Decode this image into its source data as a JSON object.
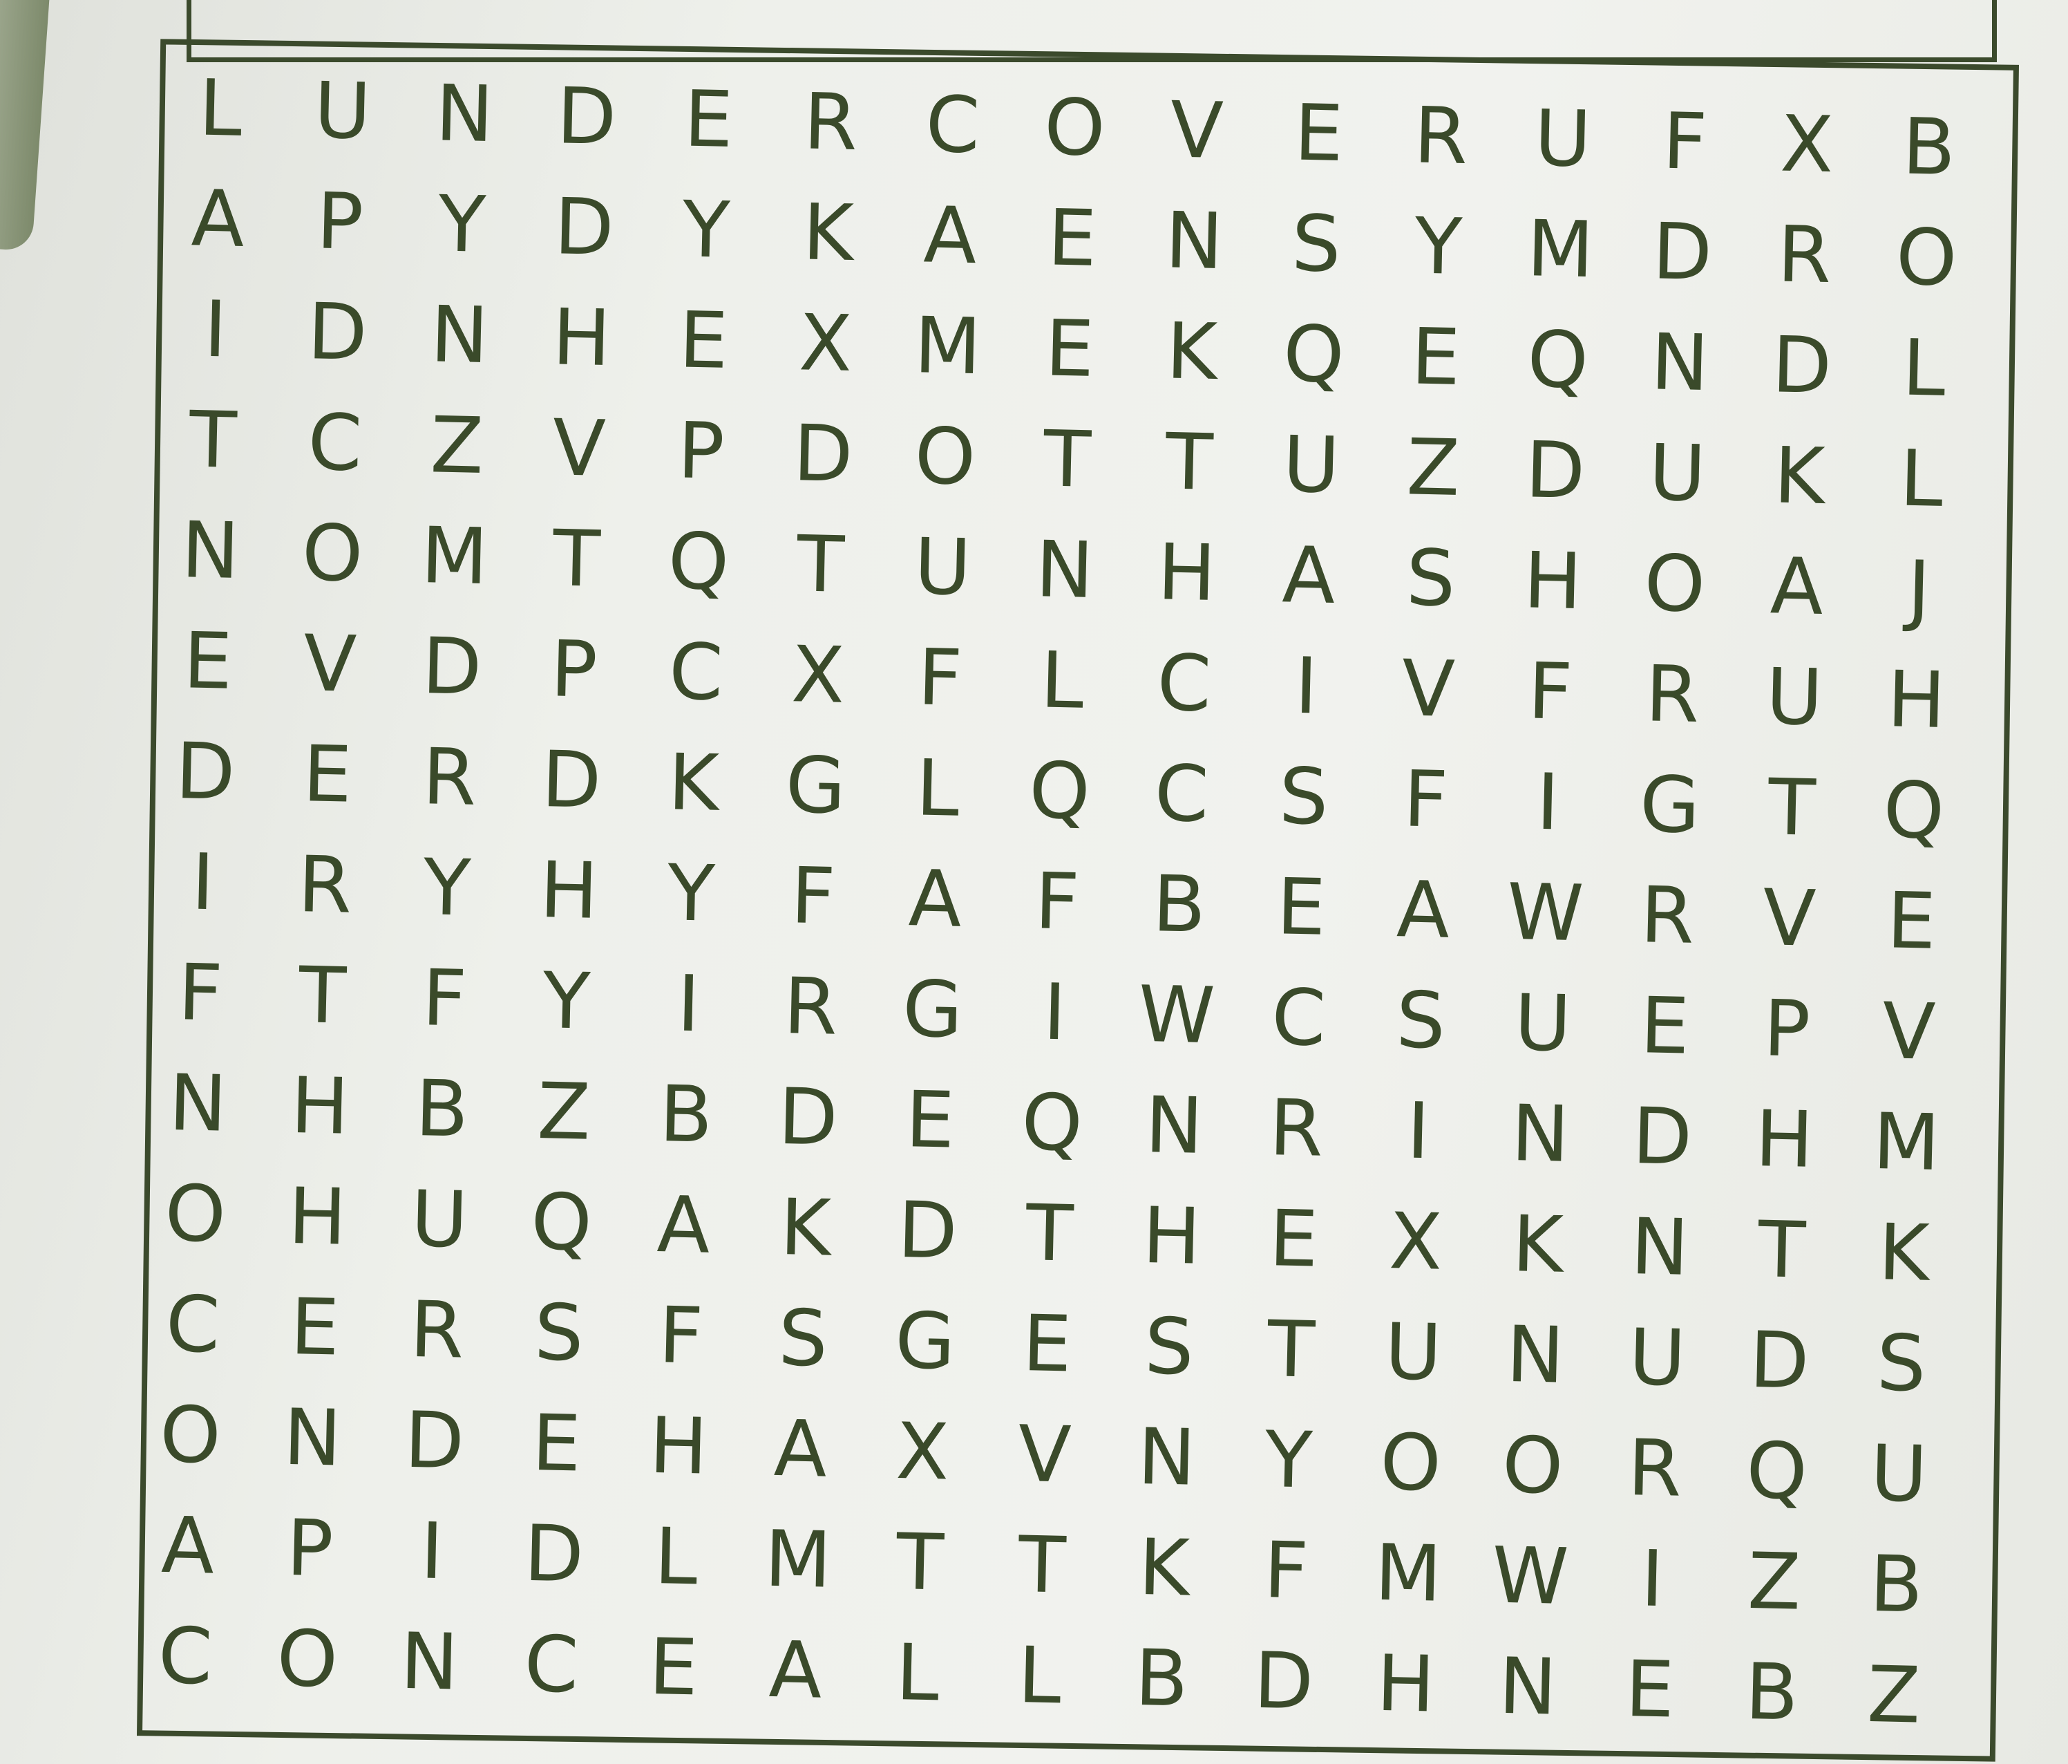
{
  "puzzle": {
    "grid": [
      [
        "L",
        "U",
        "N",
        "D",
        "E",
        "R",
        "C",
        "O",
        "V",
        "E",
        "R",
        "U",
        "F",
        "X",
        "B"
      ],
      [
        "A",
        "P",
        "Y",
        "D",
        "Y",
        "K",
        "A",
        "E",
        "N",
        "S",
        "Y",
        "M",
        "D",
        "R",
        "O"
      ],
      [
        "I",
        "D",
        "N",
        "H",
        "E",
        "X",
        "M",
        "E",
        "K",
        "Q",
        "E",
        "Q",
        "N",
        "D",
        "L"
      ],
      [
        "T",
        "C",
        "Z",
        "V",
        "P",
        "D",
        "O",
        "T",
        "T",
        "U",
        "Z",
        "D",
        "U",
        "K",
        "L"
      ],
      [
        "N",
        "O",
        "M",
        "T",
        "Q",
        "T",
        "U",
        "N",
        "H",
        "A",
        "S",
        "H",
        "O",
        "A",
        "J"
      ],
      [
        "E",
        "V",
        "D",
        "P",
        "C",
        "X",
        "F",
        "L",
        "C",
        "I",
        "V",
        "F",
        "R",
        "U",
        "H"
      ],
      [
        "D",
        "E",
        "R",
        "D",
        "K",
        "G",
        "L",
        "Q",
        "C",
        "S",
        "F",
        "I",
        "G",
        "T",
        "Q"
      ],
      [
        "I",
        "R",
        "Y",
        "H",
        "Y",
        "F",
        "A",
        "F",
        "B",
        "E",
        "A",
        "W",
        "R",
        "V",
        "E"
      ],
      [
        "F",
        "T",
        "F",
        "Y",
        "I",
        "R",
        "G",
        "I",
        "W",
        "C",
        "S",
        "U",
        "E",
        "P",
        "V"
      ],
      [
        "N",
        "H",
        "B",
        "Z",
        "B",
        "D",
        "E",
        "Q",
        "N",
        "R",
        "I",
        "N",
        "D",
        "H",
        "M"
      ],
      [
        "O",
        "H",
        "U",
        "Q",
        "A",
        "K",
        "D",
        "T",
        "H",
        "E",
        "X",
        "K",
        "N",
        "T",
        "K"
      ],
      [
        "C",
        "E",
        "R",
        "S",
        "F",
        "S",
        "G",
        "E",
        "S",
        "T",
        "U",
        "N",
        "U",
        "D",
        "S"
      ],
      [
        "O",
        "N",
        "D",
        "E",
        "H",
        "A",
        "X",
        "V",
        "N",
        "Y",
        "O",
        "O",
        "R",
        "Q",
        "U"
      ],
      [
        "A",
        "P",
        "I",
        "D",
        "L",
        "M",
        "T",
        "T",
        "K",
        "F",
        "M",
        "W",
        "I",
        "Z",
        "B"
      ],
      [
        "C",
        "O",
        "N",
        "C",
        "E",
        "A",
        "L",
        "L",
        "B",
        "D",
        "H",
        "N",
        "E",
        "B",
        "Z"
      ]
    ]
  },
  "colors": {
    "ink": "#3a4a2a",
    "paper": "#eef0eb"
  }
}
